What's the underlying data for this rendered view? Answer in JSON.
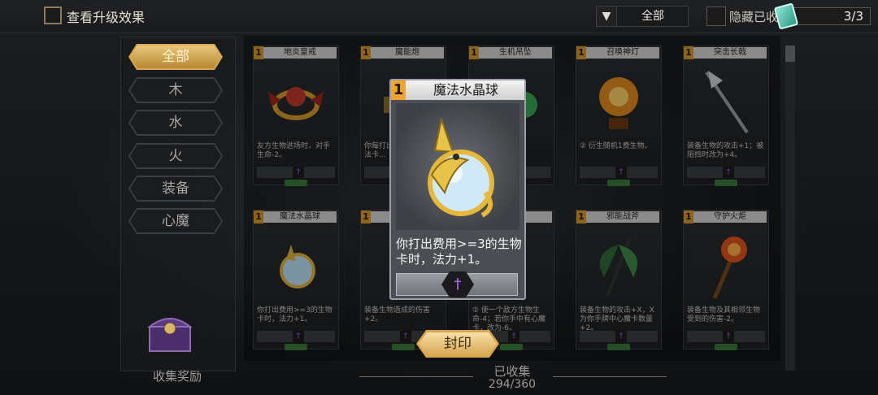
{
  "header": {
    "show_upgrade_label": "查看升级效果",
    "filter_value": "全部",
    "hide_collected_label": "隐藏已收",
    "progress_counter": "3/3"
  },
  "sidebar": {
    "categories": [
      {
        "label": "全部",
        "active": true
      },
      {
        "label": "木",
        "active": false
      },
      {
        "label": "水",
        "active": false
      },
      {
        "label": "火",
        "active": false
      },
      {
        "label": "装备",
        "active": false
      },
      {
        "label": "心魔",
        "active": false
      }
    ],
    "reward_label": "收集奖励"
  },
  "cards": [
    {
      "cost": "1",
      "name": "地炎皇戒",
      "desc": "友方生物进场时，对手生命-2。",
      "art": "ring-icon",
      "art_color": "#c0392b"
    },
    {
      "cost": "1",
      "name": "魔能炮",
      "desc": "你每打出...使使对...魔法卡...",
      "art": "cannon-icon",
      "art_color": "#8a6d2e"
    },
    {
      "cost": "1",
      "name": "生机吊坠",
      "desc": "...害后...命。",
      "art": "pendant-icon",
      "art_color": "#3aa655"
    },
    {
      "cost": "1",
      "name": "召唤神灯",
      "desc": "② 衍生随机1费生物。",
      "art": "lamp-icon",
      "art_color": "#e08a1e"
    },
    {
      "cost": "1",
      "name": "突击长戟",
      "desc": "装备生物的攻击+1；被阻挡时改为+4。",
      "art": "halberd-icon",
      "art_color": "#9aa3ad"
    },
    {
      "cost": "1",
      "name": "魔法水晶球",
      "desc": "你打出费用>=3的生物卡时，法力+1。",
      "art": "orb-icon",
      "art_color": "#8ec8f0"
    },
    {
      "cost": "1",
      "name": "",
      "desc": "装备生物造成的伤害+2。",
      "art": "blade-icon",
      "art_color": "#6c6f73"
    },
    {
      "cost": "1",
      "name": "",
      "desc": "② 使一个敌方生物生命-4；若你手中有心魔卡，改为-6。",
      "art": "claw-icon",
      "art_color": "#7a4fa0"
    },
    {
      "cost": "1",
      "name": "邪能战斧",
      "desc": "装备生物的攻击+X，X为你手牌中心魔卡数量+2。",
      "art": "axe-icon",
      "art_color": "#3f8a4a"
    },
    {
      "cost": "1",
      "name": "守护火炬",
      "desc": "装备生物及其相邻生物受到的伤害-2。",
      "art": "torch-icon",
      "art_color": "#e0531e"
    }
  ],
  "popup": {
    "cost": "1",
    "title": "魔法水晶球",
    "description": "你打出费用>=3的生物卡时，法力+1。",
    "art": "crystal-orb-icon",
    "seal_button": "封印"
  },
  "collection": {
    "label": "已收集",
    "value": "294/360"
  },
  "colors": {
    "accent_gold": "#d9a84f",
    "mana_purple": "#b86cff",
    "cost_orange": "#f0a431"
  }
}
